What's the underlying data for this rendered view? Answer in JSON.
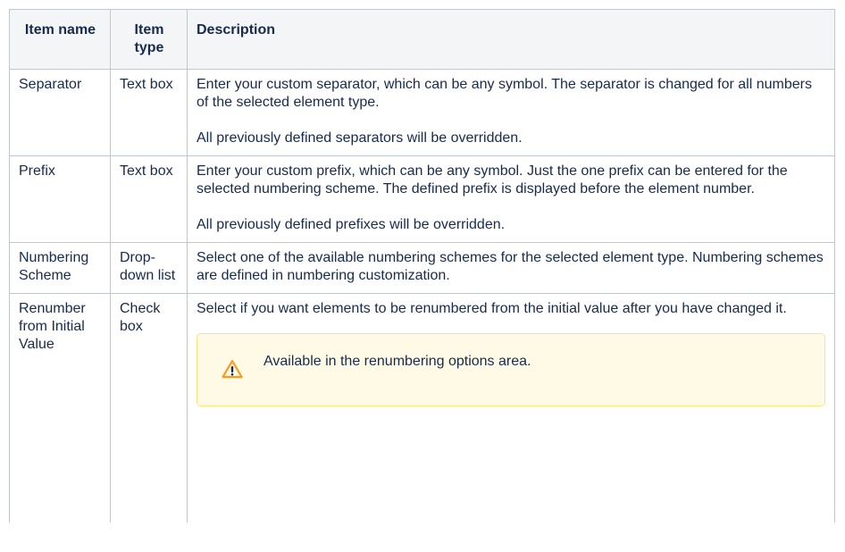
{
  "table": {
    "headers": {
      "item_name": "Item name",
      "item_type": "Item type",
      "description": "Description"
    },
    "rows": [
      {
        "name": "Separator",
        "type": "Text box",
        "paragraphs": [
          "Enter your custom separator, which can be any symbol. The separator is changed for all numbers of the selected element type.",
          "All previously defined separators will be overridden."
        ]
      },
      {
        "name": "Prefix",
        "type": "Text box",
        "paragraphs": [
          "Enter your custom prefix, which can be any symbol. Just the one prefix can be entered for the selected numbering scheme. The defined prefix is displayed before the element number.",
          "All previously defined prefixes will be overridden."
        ]
      },
      {
        "name": "Numbering Scheme",
        "type": "Drop-down list",
        "paragraphs": [
          "Select one of the available numbering schemes for the selected element type. Numbering schemes are defined in numbering customization."
        ]
      },
      {
        "name": "Renumber from Initial Value",
        "type": "Check box",
        "paragraphs": [
          "Select if you want elements to be renumbered from the initial value after you have changed it."
        ],
        "callout": {
          "icon": "warning-icon",
          "text": "Available in the renumbering options area."
        }
      }
    ]
  },
  "colors": {
    "border": "#c1c7d0",
    "header_bg": "#f4f5f7",
    "callout_bg": "#fffae6",
    "callout_border": "#ffe380",
    "warning": "#ff991f"
  }
}
